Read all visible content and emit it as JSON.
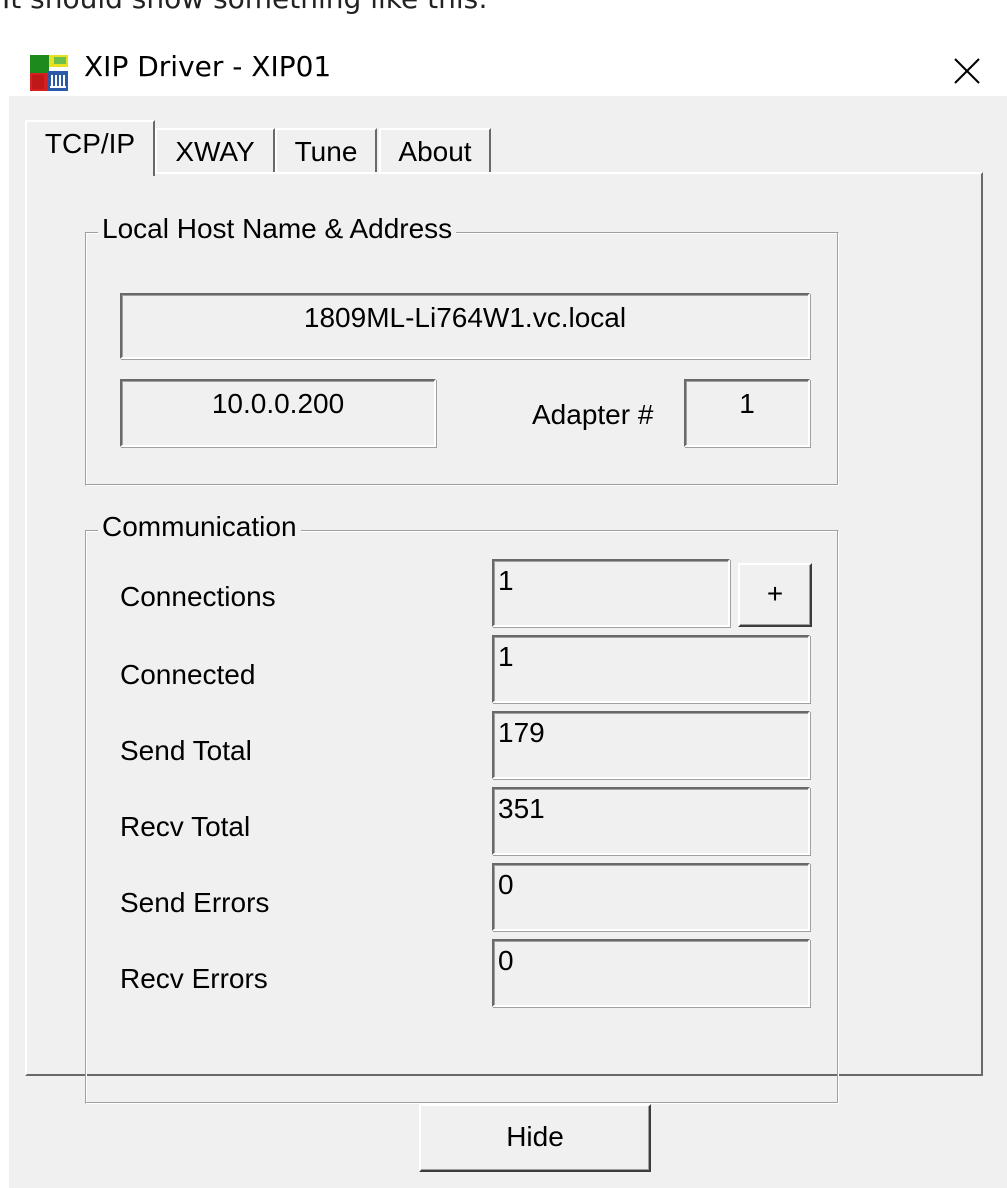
{
  "caption": "It should show something like this:",
  "window": {
    "title": "XIP Driver - XIP01",
    "close_icon": "close-icon",
    "app_icon": "xip-app-icon"
  },
  "tabs": [
    {
      "label": "TCP/IP",
      "active": true
    },
    {
      "label": "XWAY",
      "active": false
    },
    {
      "label": "Tune",
      "active": false
    },
    {
      "label": "About",
      "active": false
    }
  ],
  "local_host": {
    "group_title": "Local Host Name & Address",
    "host_name": "1809ML-Li764W1.vc.local",
    "ip_address": "10.0.0.200",
    "adapter_label": "Adapter #",
    "adapter_value": "1"
  },
  "communication": {
    "group_title": "Communication",
    "add_label": "+",
    "rows": [
      {
        "label": "Connections",
        "value": "1"
      },
      {
        "label": "Connected",
        "value": "1"
      },
      {
        "label": "Send Total",
        "value": "179"
      },
      {
        "label": "Recv Total",
        "value": "351"
      },
      {
        "label": "Send Errors",
        "value": "0"
      },
      {
        "label": "Recv Errors",
        "value": "0"
      }
    ]
  },
  "footer": {
    "hide_label": "Hide"
  }
}
